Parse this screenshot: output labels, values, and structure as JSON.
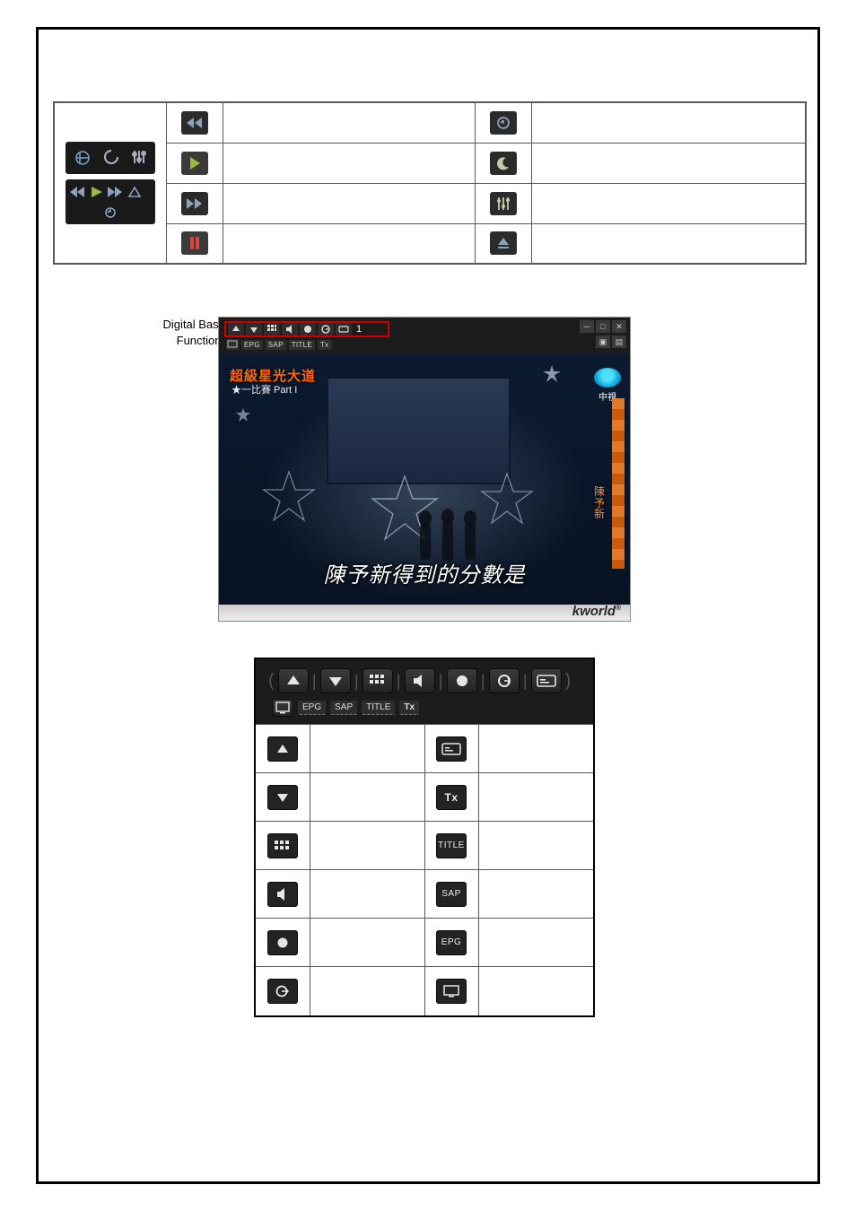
{
  "section_label": {
    "line1": "Digital Basic",
    "line2": "Functions"
  },
  "toolbar": {
    "channel_number": "1",
    "row2": [
      "EPG",
      "SAP",
      "TITLE",
      "Tx"
    ]
  },
  "screenshot": {
    "banner_title": "超級星光大道",
    "banner_sub": "★一比賽 Part I",
    "broadcaster": "中視",
    "side_name": "陳予新",
    "subtitle": "陳予新得到的分數是",
    "brand": "kworld"
  },
  "table2": {
    "banner_row2": [
      "EPG",
      "SAP",
      "TITLE",
      "Tx"
    ],
    "rows": [
      {
        "l_icon": "channel-up-icon",
        "r_icon": "caption-icon",
        "r_label": ""
      },
      {
        "l_icon": "channel-down-icon",
        "r_icon": "tx-icon",
        "r_label": "Tx"
      },
      {
        "l_icon": "grid-icon",
        "r_icon": "title-icon",
        "r_label": "TITLE"
      },
      {
        "l_icon": "mute-icon",
        "r_icon": "sap-icon",
        "r_label": "SAP"
      },
      {
        "l_icon": "record-icon",
        "r_icon": "epg-icon",
        "r_label": "EPG"
      },
      {
        "l_icon": "timeshift-icon",
        "r_icon": "display-icon",
        "r_label": ""
      }
    ]
  }
}
